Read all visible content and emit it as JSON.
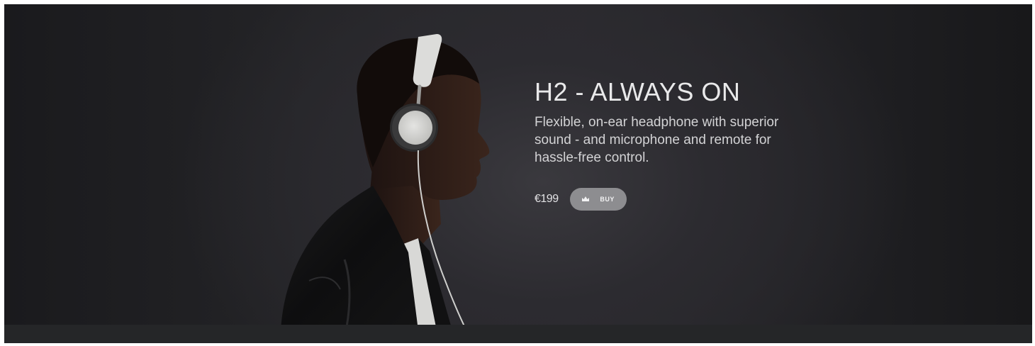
{
  "hero": {
    "headline": "H2 - ALWAYS ON",
    "description": "Flexible, on-ear headphone with superior sound - and microphone and remote for hassle-free control.",
    "price": "€199",
    "buy_label": "BUY",
    "buy_icon": "crown-icon",
    "image": "model-wearing-headphones-profile"
  },
  "colors": {
    "background": "#222225",
    "headline": "#e9e9ea",
    "button": "#8d8d90",
    "bottom_bar": "#252628"
  }
}
